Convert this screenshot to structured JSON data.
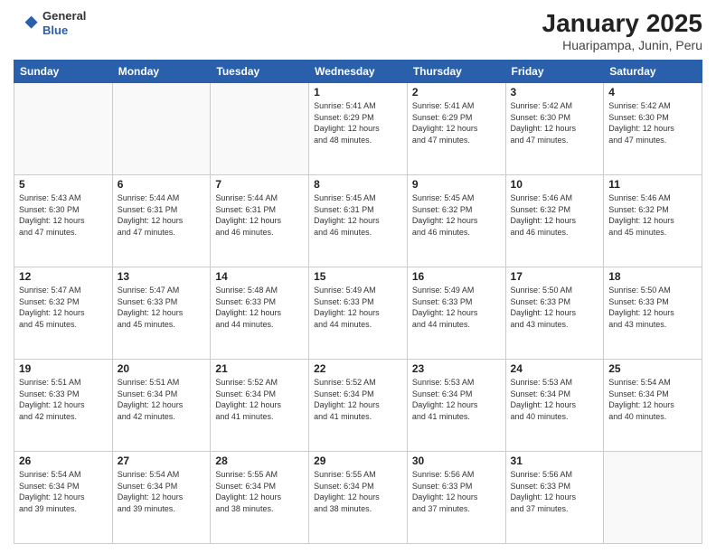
{
  "header": {
    "logo_general": "General",
    "logo_blue": "Blue",
    "title": "January 2025",
    "subtitle": "Huaripampa, Junin, Peru"
  },
  "days_of_week": [
    "Sunday",
    "Monday",
    "Tuesday",
    "Wednesday",
    "Thursday",
    "Friday",
    "Saturday"
  ],
  "weeks": [
    [
      {
        "num": "",
        "lines": []
      },
      {
        "num": "",
        "lines": []
      },
      {
        "num": "",
        "lines": []
      },
      {
        "num": "1",
        "lines": [
          "Sunrise: 5:41 AM",
          "Sunset: 6:29 PM",
          "Daylight: 12 hours",
          "and 48 minutes."
        ]
      },
      {
        "num": "2",
        "lines": [
          "Sunrise: 5:41 AM",
          "Sunset: 6:29 PM",
          "Daylight: 12 hours",
          "and 47 minutes."
        ]
      },
      {
        "num": "3",
        "lines": [
          "Sunrise: 5:42 AM",
          "Sunset: 6:30 PM",
          "Daylight: 12 hours",
          "and 47 minutes."
        ]
      },
      {
        "num": "4",
        "lines": [
          "Sunrise: 5:42 AM",
          "Sunset: 6:30 PM",
          "Daylight: 12 hours",
          "and 47 minutes."
        ]
      }
    ],
    [
      {
        "num": "5",
        "lines": [
          "Sunrise: 5:43 AM",
          "Sunset: 6:30 PM",
          "Daylight: 12 hours",
          "and 47 minutes."
        ]
      },
      {
        "num": "6",
        "lines": [
          "Sunrise: 5:44 AM",
          "Sunset: 6:31 PM",
          "Daylight: 12 hours",
          "and 47 minutes."
        ]
      },
      {
        "num": "7",
        "lines": [
          "Sunrise: 5:44 AM",
          "Sunset: 6:31 PM",
          "Daylight: 12 hours",
          "and 46 minutes."
        ]
      },
      {
        "num": "8",
        "lines": [
          "Sunrise: 5:45 AM",
          "Sunset: 6:31 PM",
          "Daylight: 12 hours",
          "and 46 minutes."
        ]
      },
      {
        "num": "9",
        "lines": [
          "Sunrise: 5:45 AM",
          "Sunset: 6:32 PM",
          "Daylight: 12 hours",
          "and 46 minutes."
        ]
      },
      {
        "num": "10",
        "lines": [
          "Sunrise: 5:46 AM",
          "Sunset: 6:32 PM",
          "Daylight: 12 hours",
          "and 46 minutes."
        ]
      },
      {
        "num": "11",
        "lines": [
          "Sunrise: 5:46 AM",
          "Sunset: 6:32 PM",
          "Daylight: 12 hours",
          "and 45 minutes."
        ]
      }
    ],
    [
      {
        "num": "12",
        "lines": [
          "Sunrise: 5:47 AM",
          "Sunset: 6:32 PM",
          "Daylight: 12 hours",
          "and 45 minutes."
        ]
      },
      {
        "num": "13",
        "lines": [
          "Sunrise: 5:47 AM",
          "Sunset: 6:33 PM",
          "Daylight: 12 hours",
          "and 45 minutes."
        ]
      },
      {
        "num": "14",
        "lines": [
          "Sunrise: 5:48 AM",
          "Sunset: 6:33 PM",
          "Daylight: 12 hours",
          "and 44 minutes."
        ]
      },
      {
        "num": "15",
        "lines": [
          "Sunrise: 5:49 AM",
          "Sunset: 6:33 PM",
          "Daylight: 12 hours",
          "and 44 minutes."
        ]
      },
      {
        "num": "16",
        "lines": [
          "Sunrise: 5:49 AM",
          "Sunset: 6:33 PM",
          "Daylight: 12 hours",
          "and 44 minutes."
        ]
      },
      {
        "num": "17",
        "lines": [
          "Sunrise: 5:50 AM",
          "Sunset: 6:33 PM",
          "Daylight: 12 hours",
          "and 43 minutes."
        ]
      },
      {
        "num": "18",
        "lines": [
          "Sunrise: 5:50 AM",
          "Sunset: 6:33 PM",
          "Daylight: 12 hours",
          "and 43 minutes."
        ]
      }
    ],
    [
      {
        "num": "19",
        "lines": [
          "Sunrise: 5:51 AM",
          "Sunset: 6:33 PM",
          "Daylight: 12 hours",
          "and 42 minutes."
        ]
      },
      {
        "num": "20",
        "lines": [
          "Sunrise: 5:51 AM",
          "Sunset: 6:34 PM",
          "Daylight: 12 hours",
          "and 42 minutes."
        ]
      },
      {
        "num": "21",
        "lines": [
          "Sunrise: 5:52 AM",
          "Sunset: 6:34 PM",
          "Daylight: 12 hours",
          "and 41 minutes."
        ]
      },
      {
        "num": "22",
        "lines": [
          "Sunrise: 5:52 AM",
          "Sunset: 6:34 PM",
          "Daylight: 12 hours",
          "and 41 minutes."
        ]
      },
      {
        "num": "23",
        "lines": [
          "Sunrise: 5:53 AM",
          "Sunset: 6:34 PM",
          "Daylight: 12 hours",
          "and 41 minutes."
        ]
      },
      {
        "num": "24",
        "lines": [
          "Sunrise: 5:53 AM",
          "Sunset: 6:34 PM",
          "Daylight: 12 hours",
          "and 40 minutes."
        ]
      },
      {
        "num": "25",
        "lines": [
          "Sunrise: 5:54 AM",
          "Sunset: 6:34 PM",
          "Daylight: 12 hours",
          "and 40 minutes."
        ]
      }
    ],
    [
      {
        "num": "26",
        "lines": [
          "Sunrise: 5:54 AM",
          "Sunset: 6:34 PM",
          "Daylight: 12 hours",
          "and 39 minutes."
        ]
      },
      {
        "num": "27",
        "lines": [
          "Sunrise: 5:54 AM",
          "Sunset: 6:34 PM",
          "Daylight: 12 hours",
          "and 39 minutes."
        ]
      },
      {
        "num": "28",
        "lines": [
          "Sunrise: 5:55 AM",
          "Sunset: 6:34 PM",
          "Daylight: 12 hours",
          "and 38 minutes."
        ]
      },
      {
        "num": "29",
        "lines": [
          "Sunrise: 5:55 AM",
          "Sunset: 6:34 PM",
          "Daylight: 12 hours",
          "and 38 minutes."
        ]
      },
      {
        "num": "30",
        "lines": [
          "Sunrise: 5:56 AM",
          "Sunset: 6:33 PM",
          "Daylight: 12 hours",
          "and 37 minutes."
        ]
      },
      {
        "num": "31",
        "lines": [
          "Sunrise: 5:56 AM",
          "Sunset: 6:33 PM",
          "Daylight: 12 hours",
          "and 37 minutes."
        ]
      },
      {
        "num": "",
        "lines": []
      }
    ]
  ]
}
